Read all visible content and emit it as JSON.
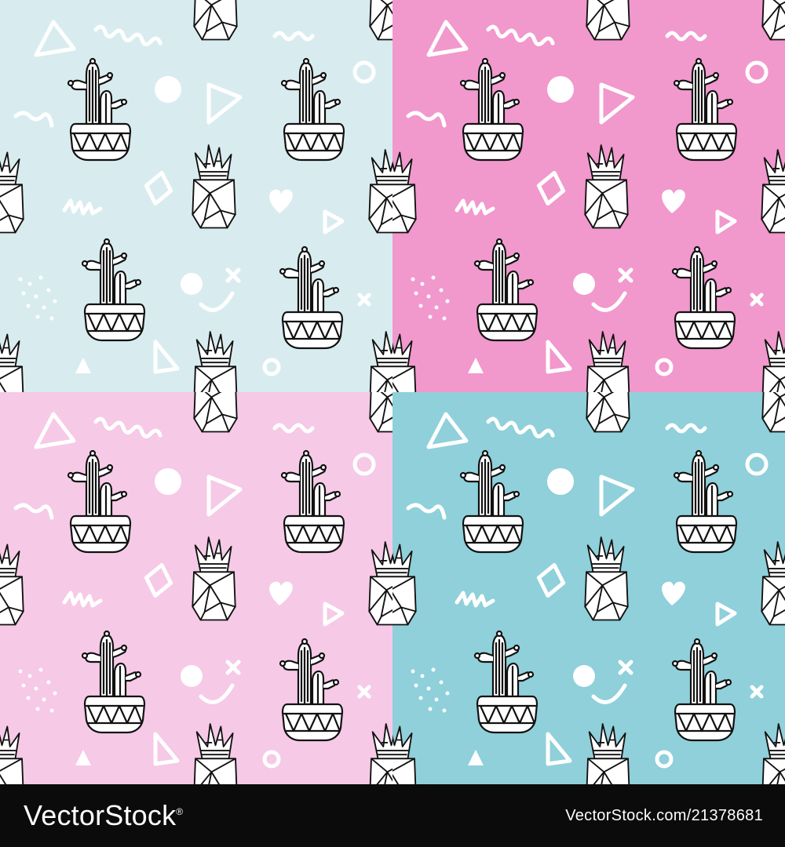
{
  "tiles": [
    {
      "name": "tile-top-left",
      "bg": "#d8ecef"
    },
    {
      "name": "tile-top-right",
      "bg": "#f198cd"
    },
    {
      "name": "tile-bottom-left",
      "bg": "#f6c9e6"
    },
    {
      "name": "tile-bottom-right",
      "bg": "#8fd0da"
    }
  ],
  "motifs": [
    "cactus-in-pot-icon",
    "succulent-in-geometric-pot-icon",
    "triangle-icon",
    "squiggle-icon",
    "circle-icon",
    "ring-icon",
    "diamond-icon",
    "heart-icon",
    "smiley-icon",
    "cross-icon",
    "dots-cluster-icon"
  ],
  "watermark": {
    "logo": "VectorStock",
    "reg": "®",
    "image_id": "VectorStock.com/21378681"
  }
}
